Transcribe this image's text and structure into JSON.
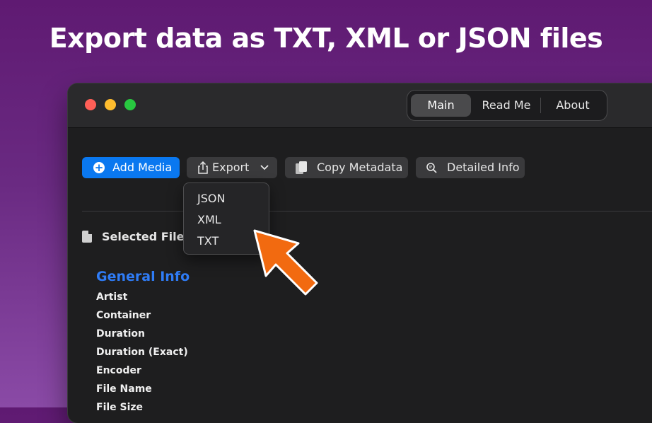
{
  "headline": "Export data as TXT, XML or JSON files",
  "window": {
    "segments": [
      {
        "label": "Main",
        "active": true
      },
      {
        "label": "Read Me",
        "active": false
      },
      {
        "label": "About",
        "active": false
      }
    ]
  },
  "toolbar": {
    "add_media": "Add Media",
    "export": "Export",
    "copy_metadata": "Copy Metadata",
    "detailed_info": "Detailed Info"
  },
  "export_menu": {
    "options": [
      "JSON",
      "XML",
      "TXT"
    ]
  },
  "selected_file_label": "Selected File: ",
  "general_info": {
    "title": "General Info",
    "fields": [
      "Artist",
      "Container",
      "Duration",
      "Duration (Exact)",
      "Encoder",
      "File Name",
      "File Size"
    ]
  },
  "colors": {
    "accent_blue": "#0a78f0",
    "section_title_blue": "#2f7cf6",
    "arrow_orange": "#f26a10"
  },
  "icons": [
    "plus-icon",
    "share-icon",
    "chevron-down-icon",
    "copy-icon",
    "magnifier-icon",
    "document-icon",
    "pointer-arrow-icon"
  ]
}
